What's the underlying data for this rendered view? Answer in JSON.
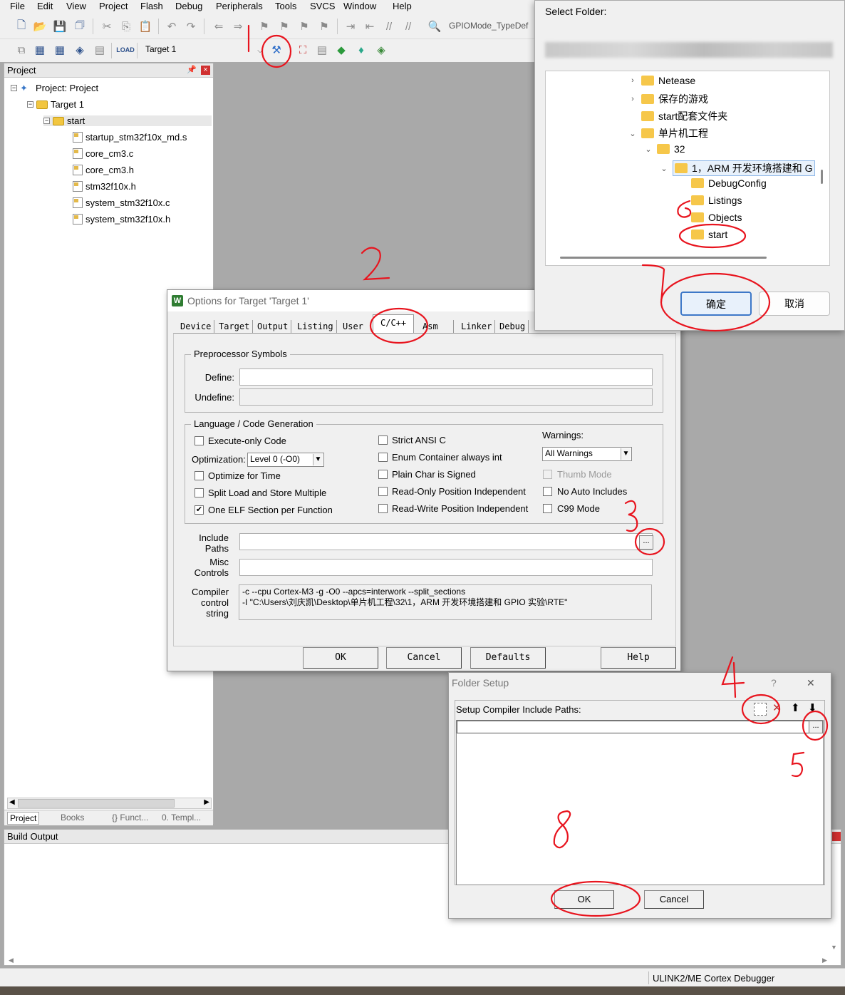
{
  "menu": [
    "File",
    "Edit",
    "View",
    "Project",
    "Flash",
    "Debug",
    "Peripherals",
    "Tools",
    "SVCS",
    "Window",
    "Help"
  ],
  "toolbar": {
    "find_combo": "GPIOMode_TypeDef",
    "target_combo": "Target 1",
    "load_label": "LOAD"
  },
  "project_panel": {
    "title": "Project",
    "pin": "ᵖ",
    "close": "×",
    "tree": {
      "root": "Project: Project",
      "target": "Target 1",
      "group": "start",
      "files": [
        "startup_stm32f10x_md.s",
        "core_cm3.c",
        "core_cm3.h",
        "stm32f10x.h",
        "system_stm32f10x.c",
        "system_stm32f10x.h"
      ]
    },
    "tabs": [
      "Project",
      "Books",
      "{} Funct...",
      "0. Templ..."
    ]
  },
  "build_output": {
    "title": "Build Output"
  },
  "status_bar": {
    "debugger": "ULINK2/ME Cortex Debugger"
  },
  "options_dialog": {
    "title": "Options for Target 'Target 1'",
    "tabs": [
      "Device",
      "Target",
      "Output",
      "Listing",
      "User",
      "C/C++",
      "Asm",
      "Linker",
      "Debug"
    ],
    "preprocessor": {
      "legend": "Preprocessor Symbols",
      "define_label": "Define:",
      "undefine_label": "Undefine:",
      "define": "",
      "undefine": ""
    },
    "language": {
      "legend": "Language / Code Generation",
      "execute_only": "Execute-only Code",
      "optimization_label": "Optimization:",
      "optimization_value": "Level 0 (-O0)",
      "optimize_time": "Optimize for Time",
      "split_load": "Split Load and Store Multiple",
      "one_elf": "One ELF Section per Function",
      "one_elf_checked": "✔",
      "strict_ansi": "Strict ANSI C",
      "enum_container": "Enum Container always int",
      "plain_char": "Plain Char is Signed",
      "ro_pos": "Read-Only Position Independent",
      "rw_pos": "Read-Write Position Independent",
      "warnings_label": "Warnings:",
      "warnings_value": "All Warnings",
      "thumb_mode": "Thumb Mode",
      "no_auto_includes": "No Auto Includes",
      "c99": "C99 Mode"
    },
    "include_paths_label": "Include\nPaths",
    "include_paths_value": "",
    "misc_controls_label": "Misc\nControls",
    "compiler_string_label": "Compiler\ncontrol\nstring",
    "compiler_string_line1": "-c --cpu Cortex-M3 -g -O0 --apcs=interwork --split_sections",
    "compiler_string_line2": "-I \"C:\\Users\\刘庆凯\\Desktop\\单片机工程\\32\\1，ARM 开发环境搭建和 GPIO 实验\\RTE\"",
    "browse_label": "...",
    "buttons": {
      "ok": "OK",
      "cancel": "Cancel",
      "defaults": "Defaults",
      "help": "Help"
    }
  },
  "select_folder": {
    "title": "Select Folder:",
    "items": [
      "Netease",
      "保存的游戏",
      "start配套文件夹",
      "单片机工程",
      "32",
      "1，ARM 开发环境搭建和 G",
      "DebugConfig",
      "Listings",
      "Objects",
      "start"
    ],
    "ok": "确定",
    "cancel": "取消"
  },
  "folder_setup": {
    "title": "Folder Setup",
    "help": "?",
    "close": "✕",
    "group_label": "Setup Compiler Include Paths:",
    "path_value": "",
    "browse_label": "...",
    "ok": "OK",
    "cancel": "Cancel"
  },
  "annotations": [
    "1",
    "2",
    "3",
    "4",
    "5",
    "6",
    "7",
    "8"
  ],
  "colors": {
    "annotation": "#e8141e",
    "workspace": "#a9a9a9",
    "folder": "#f6c74a",
    "selection": "#3d78c8"
  }
}
